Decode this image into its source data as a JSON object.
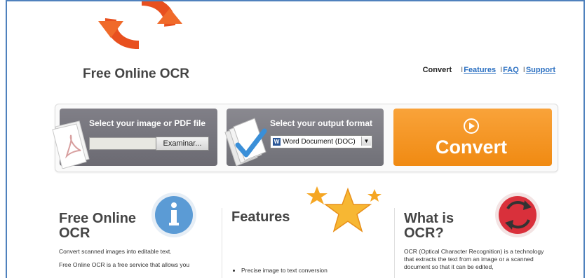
{
  "brand": {
    "name": "Free Online OCR"
  },
  "nav": {
    "active": "Convert",
    "links": [
      "Features",
      "FAQ",
      "Support"
    ]
  },
  "converter": {
    "input_title": "Select your image or PDF file",
    "browse_label": "Examinar...",
    "file_value": "",
    "output_title": "Select your output format",
    "format_selected": "Word Document (DOC)",
    "convert_label": "Convert"
  },
  "columns": {
    "free": {
      "title_line1": "Free Online",
      "title_line2": "OCR",
      "text1": "Convert scanned images into editable text.",
      "text2": "Free Online OCR is a free service that allows you"
    },
    "features": {
      "title": "Features",
      "bullets": [
        "Precise image to text conversion"
      ]
    },
    "what": {
      "title_line1": "What is",
      "title_line2": "OCR?",
      "text": "OCR (Optical Character Recognition) is a technology that extracts the text from an image or a scanned document so that it can be edited,"
    }
  },
  "colors": {
    "accent_orange": "#f08a12",
    "panel_gray": "#75747c",
    "link_blue": "#2a6fc1",
    "frame_blue": "#4f81bd"
  },
  "icons": [
    "refresh-arrows-logo-icon",
    "pdf-document-icon",
    "documents-checkmark-icon",
    "convert-play-icon",
    "info-icon",
    "stars-icon",
    "ocr-cycle-icon"
  ]
}
